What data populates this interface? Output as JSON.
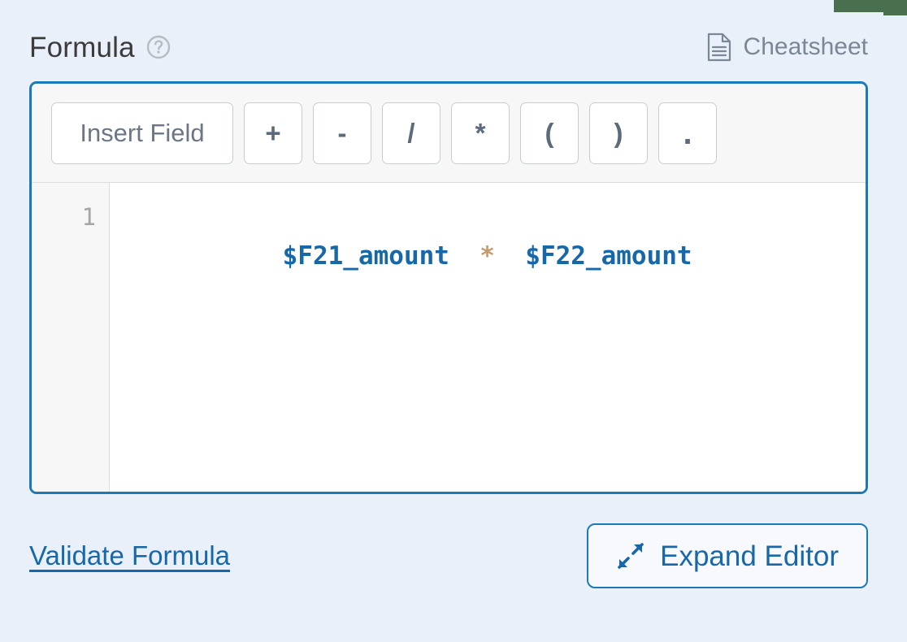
{
  "header": {
    "title": "Formula",
    "help_icon": "help-circle-icon",
    "cheatsheet": {
      "label": "Cheatsheet",
      "icon": "document-icon"
    }
  },
  "toolbar": {
    "buttons": [
      {
        "label": "Insert Field",
        "name": "insert-field-button"
      },
      {
        "label": "+",
        "name": "plus-button"
      },
      {
        "label": "-",
        "name": "minus-button"
      },
      {
        "label": "/",
        "name": "divide-button"
      },
      {
        "label": "*",
        "name": "multiply-button"
      },
      {
        "label": "(",
        "name": "open-paren-button"
      },
      {
        "label": ")",
        "name": "close-paren-button"
      },
      {
        "label": ".",
        "name": "dot-button"
      }
    ]
  },
  "editor": {
    "line_number": "1",
    "formula": "$F21_amount * $F22_amount",
    "tokens": [
      {
        "text": "$F21_amount",
        "type": "variable"
      },
      {
        "text": "  *  ",
        "type": "operator"
      },
      {
        "text": "$F22_amount",
        "type": "variable"
      }
    ]
  },
  "footer": {
    "validate_label": "Validate Formula",
    "expand_label": "Expand Editor",
    "expand_icon": "expand-arrows-icon"
  },
  "colors": {
    "page_background": "#e9f0fa",
    "accent_blue": "#1a7ab8",
    "link_blue": "#1768a8",
    "variable_blue": "#1768a8",
    "operator_tan": "#c49a6c",
    "muted_gray": "#7b8795",
    "chrome_green": "#4a6f4e"
  }
}
